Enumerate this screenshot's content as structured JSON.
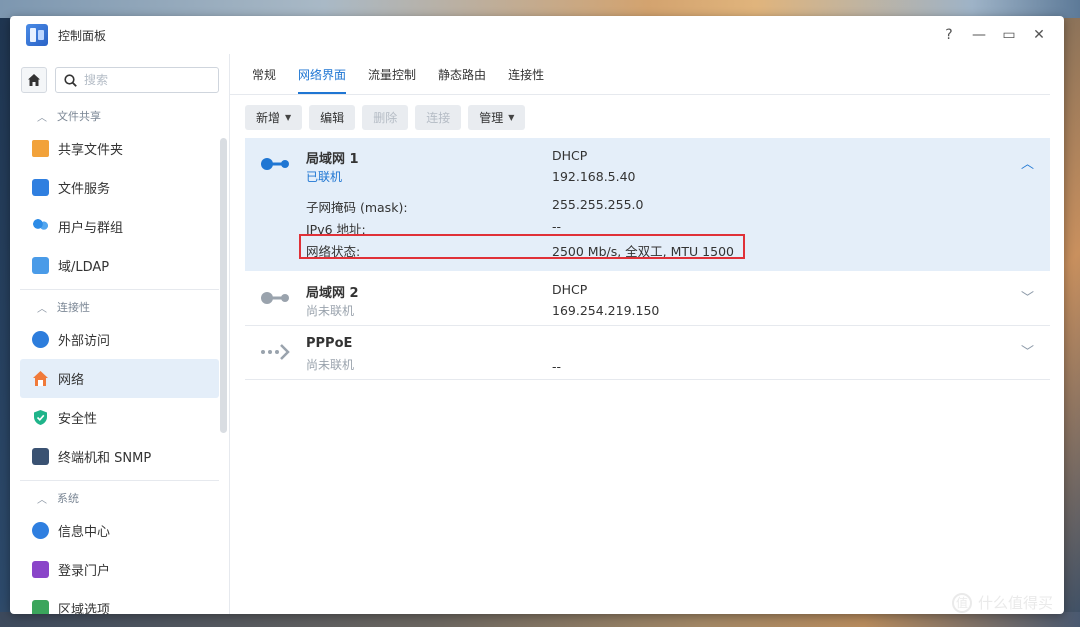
{
  "window": {
    "title": "控制面板"
  },
  "controls": {
    "help": "?",
    "minimize": "—",
    "maximize": "▭",
    "close": "✕"
  },
  "search": {
    "placeholder": "搜索"
  },
  "sidebar": {
    "sections": [
      {
        "label": "文件共享",
        "items": [
          "共享文件夹",
          "文件服务",
          "用户与群组",
          "域/LDAP"
        ]
      },
      {
        "label": "连接性",
        "items": [
          "外部访问",
          "网络",
          "安全性",
          "终端机和 SNMP"
        ]
      },
      {
        "label": "系统",
        "items": [
          "信息中心",
          "登录门户",
          "区域选项"
        ]
      }
    ],
    "active_item": "网络"
  },
  "tabs": [
    "常规",
    "网络界面",
    "流量控制",
    "静态路由",
    "连接性"
  ],
  "active_tab": "网络界面",
  "toolbar": {
    "create": "新增",
    "edit": "编辑",
    "delete": "删除",
    "connect": "连接",
    "manage": "管理"
  },
  "interfaces": [
    {
      "name": "局域网 1",
      "status": "已联机",
      "connected": true,
      "type": "DHCP",
      "ip": "192.168.5.40",
      "expanded": true,
      "details": [
        {
          "label": "子网掩码 (mask):",
          "value": "255.255.255.0"
        },
        {
          "label": "IPv6 地址:",
          "value": "--"
        },
        {
          "label": "网络状态:",
          "value": "2500 Mb/s, 全双工, MTU 1500"
        }
      ]
    },
    {
      "name": "局域网 2",
      "status": "尚未联机",
      "connected": false,
      "type": "DHCP",
      "ip": "169.254.219.150",
      "expanded": false
    },
    {
      "name": "PPPoE",
      "status": "尚未联机",
      "connected": false,
      "type": "",
      "ip": "--",
      "expanded": false
    }
  ],
  "colors": {
    "accent": "#1f76d3",
    "highlight": "#e03138",
    "selected_bg": "#e4eef9"
  },
  "watermark": {
    "text": "什么值得买",
    "logo": "值"
  }
}
